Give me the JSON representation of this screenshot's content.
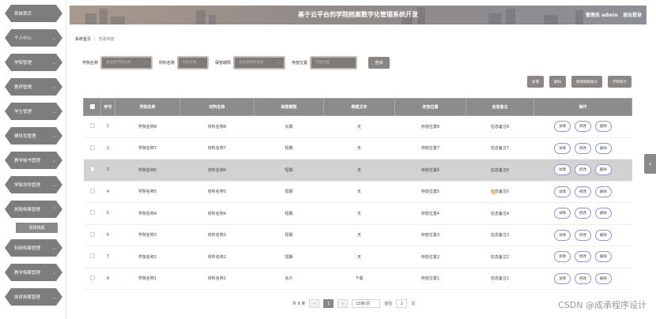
{
  "sidebar": {
    "items": [
      {
        "label": "系统首页",
        "chevron": ""
      },
      {
        "label": "个人中心",
        "chevron": "⌄"
      },
      {
        "label": "学院管理",
        "chevron": "⌄"
      },
      {
        "label": "教师管理",
        "chevron": "⌄"
      },
      {
        "label": "学生管理",
        "chevron": "⌄"
      },
      {
        "label": "辅导员管理",
        "chevron": "⌄"
      },
      {
        "label": "教学秘书管理",
        "chevron": "⌄"
      },
      {
        "label": "学院领导管理",
        "chevron": "⌄"
      },
      {
        "label": "党政档案管理",
        "chevron": "⌃"
      }
    ],
    "sub_item": "党政档案",
    "items_after": [
      {
        "label": "科研档案管理",
        "chevron": "⌄"
      },
      {
        "label": "教学档案管理",
        "chevron": "⌄"
      },
      {
        "label": "体育档案管理",
        "chevron": "⌄"
      }
    ]
  },
  "header": {
    "title": "基于云平台的学院档案数字化管理系统开发",
    "role": "管理员 admin",
    "logout": "退出登录"
  },
  "breadcrumb": {
    "home": "系统首页",
    "current": "党政档案"
  },
  "filters": {
    "college_label": "学院名称",
    "college_placeholder": "请选择学院名称",
    "material_label": "材料名称",
    "material_placeholder": "材料名称",
    "period_label": "保管期限",
    "period_placeholder": "请选择保管期限",
    "location_label": "存放位置",
    "location_placeholder": "存放位置",
    "search_label": "查询"
  },
  "actions": [
    "新增",
    "删除",
    "保管期限统计",
    "学院统计"
  ],
  "table": {
    "headers": [
      "序号",
      "学院名称",
      "材料名称",
      "保管期限",
      "档案文件",
      "存放位置",
      "信息备注",
      "操作"
    ],
    "rows": [
      {
        "no": "1",
        "college": "学院名称8",
        "material": "材料名称8",
        "period": "长期",
        "file": "无",
        "location": "存放位置8",
        "remark": "信息备注8"
      },
      {
        "no": "2",
        "college": "学院名称7",
        "material": "材料名称7",
        "period": "短期",
        "file": "无",
        "location": "存放位置7",
        "remark": "信息备注7"
      },
      {
        "no": "3",
        "college": "学院名称6",
        "material": "材料名称6",
        "period": "短期",
        "file": "无",
        "location": "存放位置6",
        "remark": "信息备注6"
      },
      {
        "no": "4",
        "college": "学院名称5",
        "material": "材料名称5",
        "period": "短期",
        "file": "无",
        "location": "存放位置5",
        "remark": "信息备注5"
      },
      {
        "no": "5",
        "college": "学院名称4",
        "material": "材料名称4",
        "period": "短期",
        "file": "无",
        "location": "存放位置4",
        "remark": "信息备注4"
      },
      {
        "no": "6",
        "college": "学院名称3",
        "material": "材料名称3",
        "period": "短期",
        "file": "无",
        "location": "存放位置3",
        "remark": "信息备注3"
      },
      {
        "no": "7",
        "college": "学院名称2",
        "material": "材料名称2",
        "period": "短期",
        "file": "无",
        "location": "存放位置2",
        "remark": "信息备注2"
      },
      {
        "no": "8",
        "college": "学院名称1",
        "material": "材料名称1",
        "period": "永久",
        "file": "下载",
        "location": "存放位置1",
        "remark": "信息备注1"
      }
    ],
    "op_labels": [
      "详情",
      "修改",
      "删除"
    ]
  },
  "pagination": {
    "total": "共 8 条",
    "prev": "<",
    "current": "1",
    "next": ">",
    "page_size": "10条/页",
    "goto_label": "前往",
    "goto_value": "1",
    "page_unit": "页"
  },
  "watermark": "CSDN @成承程序设计",
  "colors": {
    "accent": "#8b8686",
    "sidebar_item": "#7d7d7d",
    "header_start": "#a8998e",
    "header_end": "#8d8f96",
    "op_border": "#8c98d6"
  }
}
